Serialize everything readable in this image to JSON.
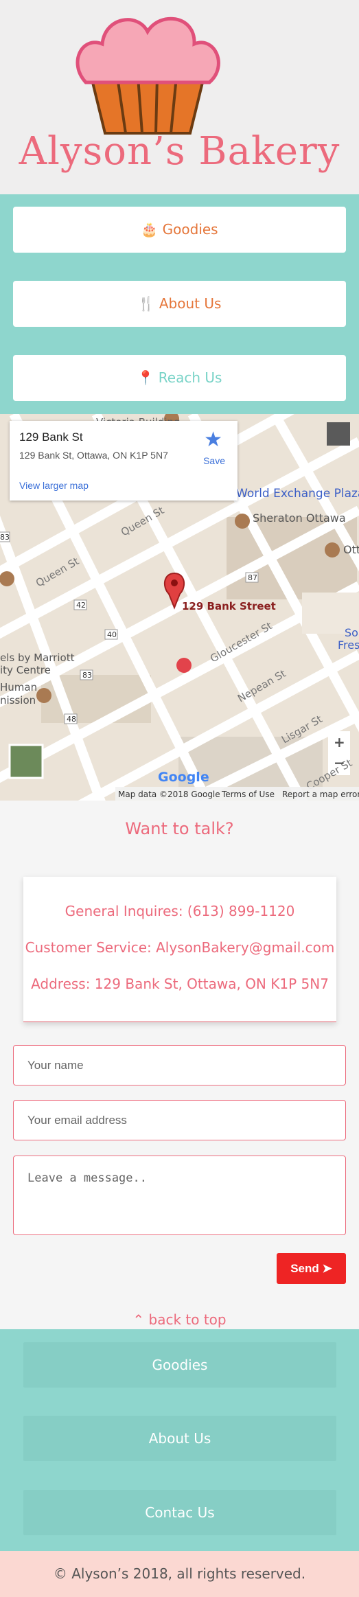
{
  "header": {
    "title": "Alyson’s Bakery"
  },
  "nav": [
    {
      "label": "Goodies",
      "icon": "cake-icon"
    },
    {
      "label": "About Us",
      "icon": "utensils-icon"
    },
    {
      "label": "Reach Us",
      "icon": "map-pin-icon"
    }
  ],
  "map": {
    "card_title": "129 Bank St",
    "card_address": "129 Bank St, Ottawa, ON K1P 5N7",
    "card_link": "View larger map",
    "save_label": "Save",
    "labels": [
      "Victoria Building",
      "World Exchange Plaza",
      "Sheraton Ottawa",
      "Queen St",
      "Queen St",
      "129 Bank Street",
      "Gloucester St",
      "Nepean St",
      "Lisgar St",
      "Cooper St",
      "els by Marriott",
      "ity Centre",
      "Human",
      "nission",
      "Ott",
      "So",
      "Fres"
    ],
    "road_badges": [
      "83",
      "42",
      "87",
      "40",
      "83",
      "48"
    ],
    "attribution": "Map data ©2018 Google",
    "terms": "Terms of Use",
    "report": "Report a map error",
    "google": "Google",
    "zoom_in": "+",
    "zoom_out": "−"
  },
  "contact": {
    "heading": "Want to talk?",
    "general": "General Inquires: (613) 899-1120",
    "service": "Customer Service: AlysonBakery@gmail.com",
    "address": "Address: 129 Bank St, Ottawa, ON K1P 5N7"
  },
  "form": {
    "name_placeholder": "Your name",
    "email_placeholder": "Your email address",
    "message_placeholder": "Leave a message..",
    "send_label": "Send"
  },
  "back_to_top": "back to top",
  "footer": {
    "links": [
      "Goodies",
      "About Us",
      "Contac Us"
    ],
    "copyright": "© Alyson’s 2018, all rights reserved."
  },
  "colors": {
    "teal": "#8ed6cd",
    "pink": "#ec6a7c",
    "orange": "#e5763a",
    "red": "#ee2424"
  }
}
